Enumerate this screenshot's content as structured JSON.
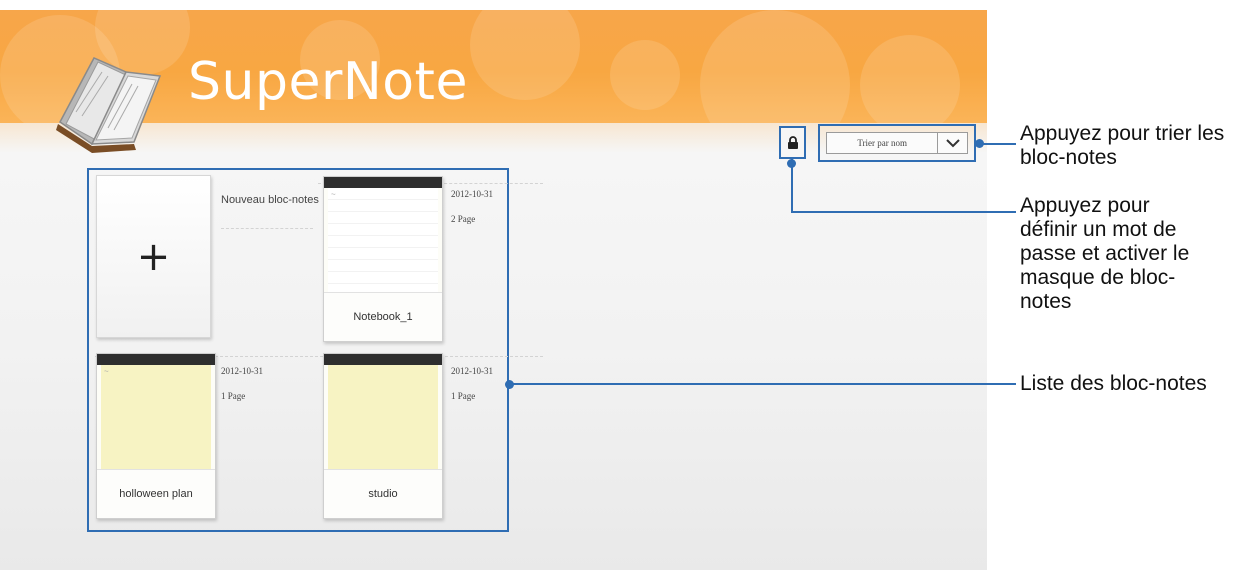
{
  "app": {
    "title": "SuperNote"
  },
  "toolbar": {
    "lock_icon": "lock-icon",
    "sort_label": "Trier par nom",
    "sort_chevron_icon": "chevron-down-icon"
  },
  "notebooks": {
    "new_tile": {
      "icon": "plus",
      "symbol": "+",
      "label": "Nouveau bloc-notes"
    },
    "items": [
      {
        "name": "Notebook_1",
        "date": "2012-10-31",
        "pages": "2 Page",
        "page_style": "lined"
      },
      {
        "name": "holloween plan",
        "date": "2012-10-31",
        "pages": "1 Page",
        "page_style": "yellow"
      },
      {
        "name": "studio",
        "date": "2012-10-31",
        "pages": "1 Page",
        "page_style": "yellow"
      }
    ]
  },
  "callouts": {
    "sort": "Appuyez pour trier les bloc-notes",
    "lock": "Appuyez pour définir un mot de passe et activer le masque de bloc-notes",
    "list": "Liste des bloc-notes"
  },
  "colors": {
    "banner": "#f8a742",
    "callout": "#2f6db3"
  }
}
